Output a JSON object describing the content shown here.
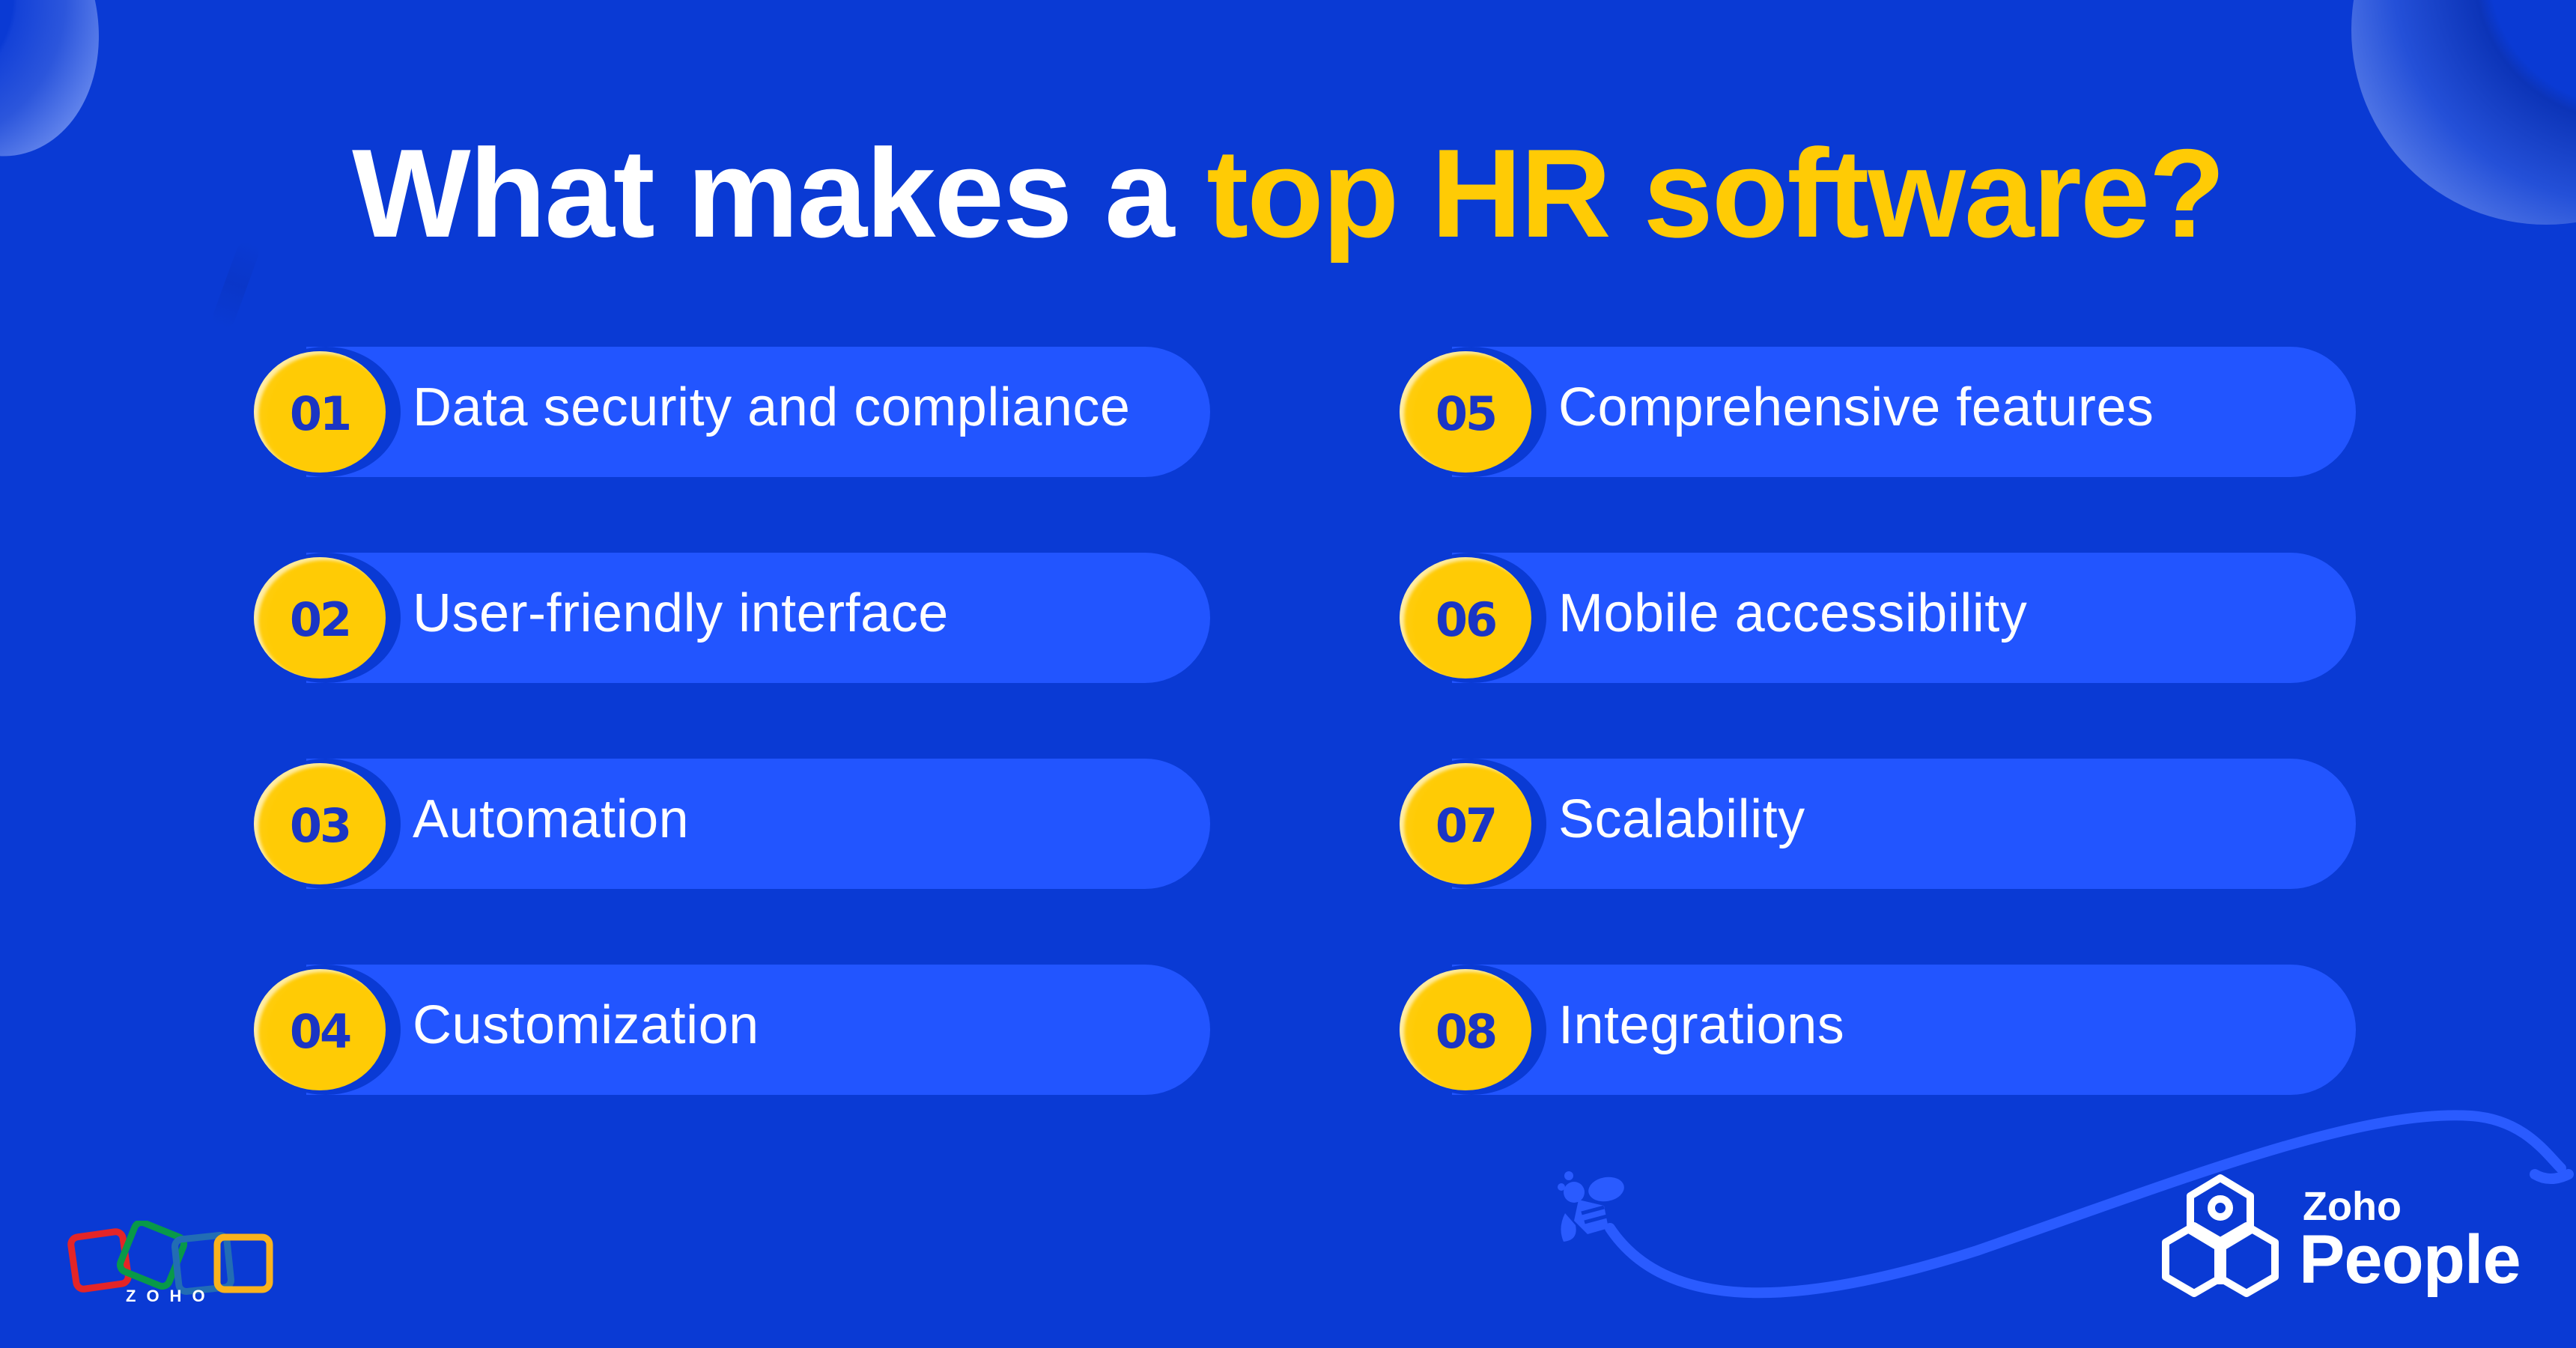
{
  "title": {
    "prefix": "What makes a ",
    "highlight": "top HR software?"
  },
  "colors": {
    "background": "#0a3ad4",
    "pill": "#2255ff",
    "badge": "#ffcb05",
    "badge_text": "#1a35c4",
    "highlight": "#ffcb05",
    "text": "#ffffff"
  },
  "items": [
    {
      "number": "01",
      "label": "Data security and compliance"
    },
    {
      "number": "02",
      "label": "User-friendly interface"
    },
    {
      "number": "03",
      "label": "Automation"
    },
    {
      "number": "04",
      "label": "Customization"
    },
    {
      "number": "05",
      "label": "Comprehensive features"
    },
    {
      "number": "06",
      "label": "Mobile accessibility"
    },
    {
      "number": "07",
      "label": "Scalability"
    },
    {
      "number": "08",
      "label": "Integrations"
    }
  ],
  "branding": {
    "zoho_wordmark": "ZOHO",
    "product_brand": "Zoho",
    "product_name": "People"
  },
  "icons": {
    "zoho_logo": "zoho-squares-logo",
    "people_logo": "hexagon-people-icon",
    "bee": "bee-icon"
  }
}
